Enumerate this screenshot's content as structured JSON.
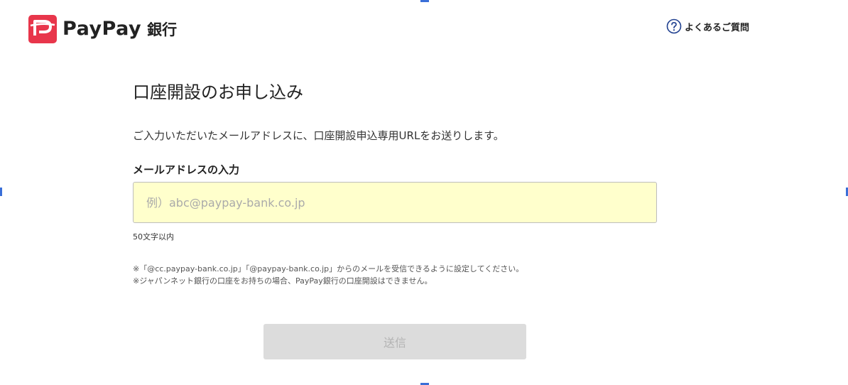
{
  "header": {
    "logo_text": "PayPay",
    "logo_sub": "銀行",
    "faq_label": "よくあるご質問"
  },
  "main": {
    "title": "口座開設のお申し込み",
    "lead": "ご入力いただいたメールアドレスに、口座開設申込専用URLをお送りします。",
    "email_label": "メールアドレスの入力",
    "email_value": "",
    "email_placeholder": "例）abc@paypay-bank.co.jp",
    "char_limit": "50文字以内",
    "notes": [
      "※「@cc.paypay-bank.co.jp」「@paypay-bank.co.jp」からのメールを受信できるように設定してください。",
      "※ジャパンネット銀行の口座をお持ちの場合、PayPay銀行の口座開設はできません。"
    ],
    "submit_label": "送信"
  },
  "colors": {
    "brand_red": "#e8364b",
    "input_bg": "#ffffcc",
    "button_disabled_bg": "#dcdcdc",
    "button_disabled_text": "#b3b3b3"
  },
  "icons": {
    "logo": "paypay-logo-icon",
    "faq": "question-circle-icon"
  }
}
